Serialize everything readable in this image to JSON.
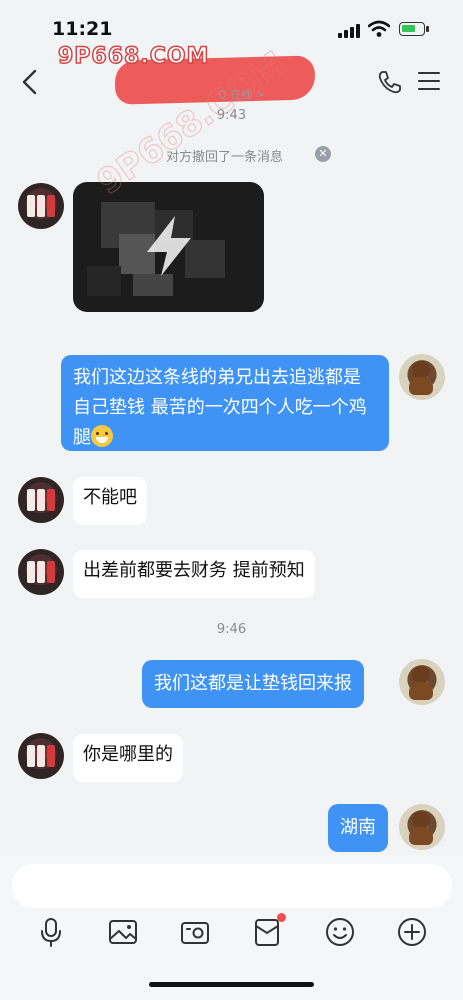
{
  "status_bar": {
    "time": "11:21"
  },
  "watermark": {
    "text": "9P668.COM",
    "diagonal": "9P668.COM"
  },
  "header": {
    "subtitle": "Q 在线 >"
  },
  "messages": {
    "ts1": "9:43",
    "recall_notice": "对方撤回了一条消息",
    "m_right_1": "我们这边这条线的弟兄出去追逃都是自己垫钱 最苦的一次四个人吃一个鸡腿",
    "m_left_1": "不能吧",
    "m_left_2": "出差前都要去财务 提前预知",
    "ts2": "9:46",
    "m_right_2": "我们这都是让垫钱回来报",
    "m_left_3": "你是哪里的",
    "m_right_3": "湖南"
  },
  "icons": {
    "back": "chevron-left-icon",
    "phone": "phone-icon",
    "menu": "menu-icon",
    "toolbar": [
      "microphone-icon",
      "image-icon",
      "camera-icon",
      "red-packet-icon",
      "emoji-icon",
      "plus-icon"
    ]
  },
  "colors": {
    "accent": "#3f93f5",
    "badge": "#f04e4e",
    "background": "#f2f3f5"
  }
}
